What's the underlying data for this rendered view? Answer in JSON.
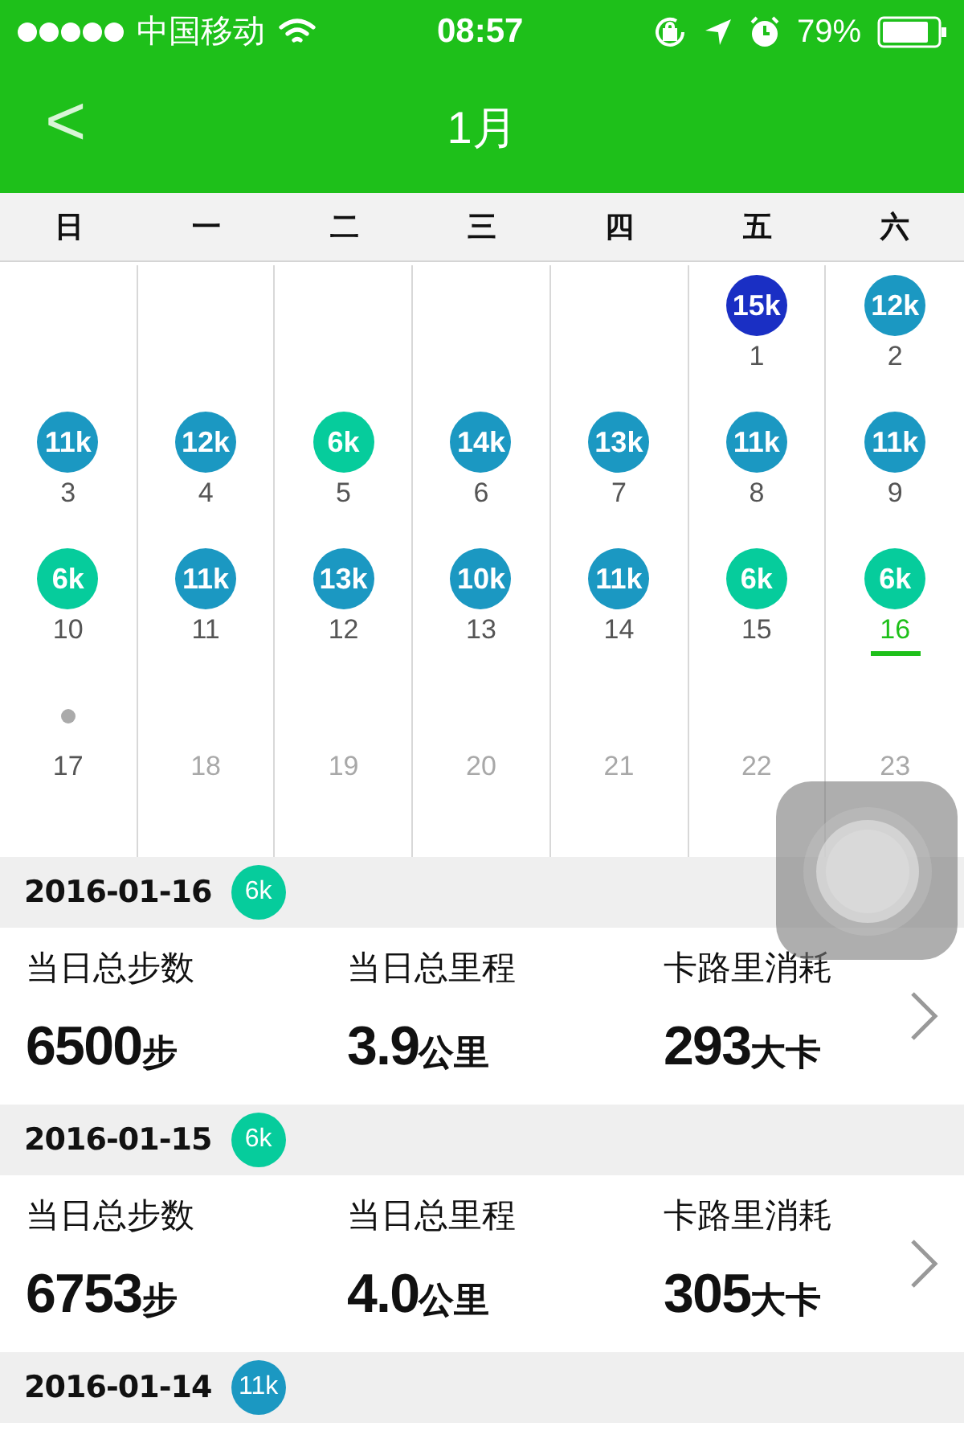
{
  "status_bar": {
    "carrier": "中国移动",
    "time": "08:57",
    "battery": "79%"
  },
  "nav": {
    "back": "<",
    "title": "1月"
  },
  "weekdays": [
    "日",
    "一",
    "二",
    "三",
    "四",
    "五",
    "六"
  ],
  "weeks": [
    [
      {
        "kind": "empty"
      },
      {
        "kind": "empty"
      },
      {
        "kind": "empty"
      },
      {
        "kind": "empty"
      },
      {
        "kind": "empty"
      },
      {
        "kind": "badge",
        "badge": "15k",
        "color": "#1a2fc4",
        "day": "1",
        "selected": false,
        "disabled": false
      },
      {
        "kind": "badge",
        "badge": "12k",
        "color": "#1b98c2",
        "day": "2",
        "selected": false,
        "disabled": false
      }
    ],
    [
      {
        "kind": "badge",
        "badge": "11k",
        "color": "#1b98c2",
        "day": "3",
        "selected": false,
        "disabled": false
      },
      {
        "kind": "badge",
        "badge": "12k",
        "color": "#1b98c2",
        "day": "4",
        "selected": false,
        "disabled": false
      },
      {
        "kind": "badge",
        "badge": "6k",
        "color": "#06cc9c",
        "day": "5",
        "selected": false,
        "disabled": false
      },
      {
        "kind": "badge",
        "badge": "14k",
        "color": "#1b98c2",
        "day": "6",
        "selected": false,
        "disabled": false
      },
      {
        "kind": "badge",
        "badge": "13k",
        "color": "#1b98c2",
        "day": "7",
        "selected": false,
        "disabled": false
      },
      {
        "kind": "badge",
        "badge": "11k",
        "color": "#1b98c2",
        "day": "8",
        "selected": false,
        "disabled": false
      },
      {
        "kind": "badge",
        "badge": "11k",
        "color": "#1b98c2",
        "day": "9",
        "selected": false,
        "disabled": false
      }
    ],
    [
      {
        "kind": "badge",
        "badge": "6k",
        "color": "#06cc9c",
        "day": "10",
        "selected": false,
        "disabled": false
      },
      {
        "kind": "badge",
        "badge": "11k",
        "color": "#1b98c2",
        "day": "11",
        "selected": false,
        "disabled": false
      },
      {
        "kind": "badge",
        "badge": "13k",
        "color": "#1b98c2",
        "day": "12",
        "selected": false,
        "disabled": false
      },
      {
        "kind": "badge",
        "badge": "10k",
        "color": "#1b98c2",
        "day": "13",
        "selected": false,
        "disabled": false
      },
      {
        "kind": "badge",
        "badge": "11k",
        "color": "#1b98c2",
        "day": "14",
        "selected": false,
        "disabled": false
      },
      {
        "kind": "badge",
        "badge": "6k",
        "color": "#06cc9c",
        "day": "15",
        "selected": false,
        "disabled": false
      },
      {
        "kind": "badge",
        "badge": "6k",
        "color": "#06cc9c",
        "day": "16",
        "selected": true,
        "disabled": false
      }
    ],
    [
      {
        "kind": "dot",
        "day": "17",
        "selected": false,
        "disabled": false
      },
      {
        "kind": "plain",
        "day": "18",
        "selected": false,
        "disabled": true
      },
      {
        "kind": "plain",
        "day": "19",
        "selected": false,
        "disabled": true
      },
      {
        "kind": "plain",
        "day": "20",
        "selected": false,
        "disabled": true
      },
      {
        "kind": "plain",
        "day": "21",
        "selected": false,
        "disabled": true
      },
      {
        "kind": "plain",
        "day": "22",
        "selected": false,
        "disabled": true
      },
      {
        "kind": "plain",
        "day": "23",
        "selected": false,
        "disabled": true
      }
    ]
  ],
  "records": [
    {
      "date": "2016-01-16",
      "badge": "6k",
      "color": "#06cc9c",
      "stats": [
        {
          "label": "当日总步数",
          "value": "6500",
          "unit": "步"
        },
        {
          "label": "当日总里程",
          "value": "3.9",
          "unit": "公里"
        },
        {
          "label": "卡路里消耗",
          "value": "293",
          "unit": "大卡"
        }
      ]
    },
    {
      "date": "2016-01-15",
      "badge": "6k",
      "color": "#06cc9c",
      "stats": [
        {
          "label": "当日总步数",
          "value": "6753",
          "unit": "步"
        },
        {
          "label": "当日总里程",
          "value": "4.0",
          "unit": "公里"
        },
        {
          "label": "卡路里消耗",
          "value": "305",
          "unit": "大卡"
        }
      ]
    },
    {
      "date": "2016-01-14",
      "badge": "11k",
      "color": "#1b98c2"
    }
  ]
}
